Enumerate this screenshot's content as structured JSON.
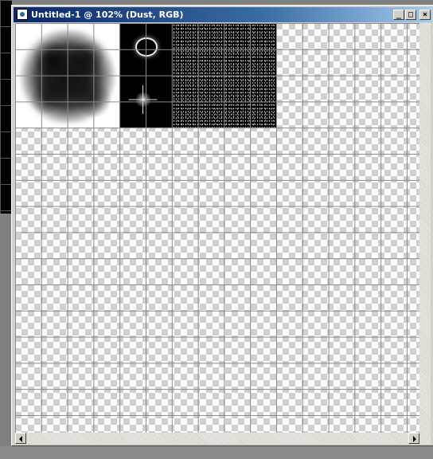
{
  "window": {
    "title": "Untitled-1 @ 102% (Dust, RGB)"
  },
  "icons": {
    "app": "photoshop-document-icon",
    "minimize": "minimize-icon",
    "maximize": "maximize-icon",
    "close": "close-icon",
    "scroll_left": "chevron-left-icon",
    "scroll_right": "chevron-right-icon"
  },
  "titlebar_buttons": {
    "minimize_glyph": "_",
    "maximize_glyph": "□",
    "close_glyph": "×"
  },
  "colors": {
    "titlebar_start": "#0a246a",
    "titlebar_end": "#a6caf0",
    "window_face": "#d4d0c8",
    "desktop": "#7f7f7f"
  }
}
